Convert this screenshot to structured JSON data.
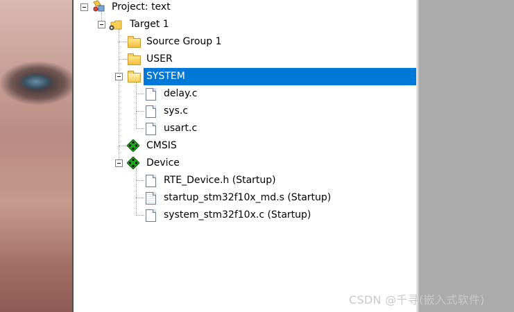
{
  "tree": {
    "project": {
      "label": "Project: text"
    },
    "target": {
      "label": "Target 1"
    },
    "groups": [
      {
        "label": "Source Group 1"
      },
      {
        "label": "USER"
      },
      {
        "label": "SYSTEM",
        "selected": true,
        "files": [
          {
            "label": "delay.c"
          },
          {
            "label": "sys.c"
          },
          {
            "label": "usart.c"
          }
        ]
      },
      {
        "label": "CMSIS"
      },
      {
        "label": "Device",
        "files": [
          {
            "label": "RTE_Device.h (Startup)"
          },
          {
            "label": "startup_stm32f10x_md.s (Startup)"
          },
          {
            "label": "system_stm32f10x.c (Startup)"
          }
        ]
      }
    ]
  },
  "colors": {
    "selection": "#0078d7",
    "right_pane": "#ababab"
  },
  "watermark": "CSDN @千寻(嵌入式软件)"
}
